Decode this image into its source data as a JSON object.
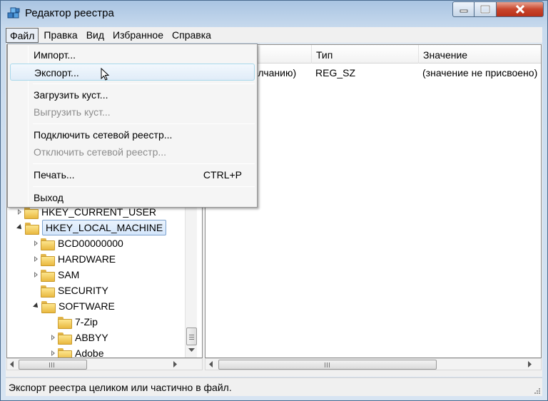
{
  "window": {
    "title": "Редактор реестра"
  },
  "menubar": {
    "items": [
      "Файл",
      "Правка",
      "Вид",
      "Избранное",
      "Справка"
    ]
  },
  "file_menu": {
    "items": [
      {
        "label": "Импорт...",
        "enabled": true
      },
      {
        "label": "Экспорт...",
        "enabled": true,
        "highlighted": true
      },
      {
        "label": "Загрузить куст...",
        "enabled": true
      },
      {
        "label": "Выгрузить куст...",
        "enabled": false
      },
      {
        "label": "Подключить сетевой реестр...",
        "enabled": true
      },
      {
        "label": "Отключить сетевой реестр...",
        "enabled": false
      },
      {
        "label": "Печать...",
        "enabled": true,
        "shortcut": "CTRL+P"
      },
      {
        "label": "Выход",
        "enabled": true
      }
    ]
  },
  "tree": {
    "items": [
      {
        "label": "HKEY_CURRENT_USER",
        "expander": "closed"
      },
      {
        "label": "HKEY_LOCAL_MACHINE",
        "expander": "open",
        "selected": true
      },
      {
        "label": "BCD00000000",
        "expander": "closed"
      },
      {
        "label": "HARDWARE",
        "expander": "closed"
      },
      {
        "label": "SAM",
        "expander": "closed"
      },
      {
        "label": "SECURITY",
        "expander": "none"
      },
      {
        "label": "SOFTWARE",
        "expander": "open"
      },
      {
        "label": "7-Zip",
        "expander": "none"
      },
      {
        "label": "ABBYY",
        "expander": "closed"
      },
      {
        "label": "Adobe",
        "expander": "closed"
      }
    ]
  },
  "list": {
    "columns": [
      "Тип",
      "Значение"
    ],
    "rows": [
      {
        "name": "олчанию)",
        "type": "REG_SZ",
        "value": "(значение не присвоено)"
      }
    ]
  },
  "status": {
    "text": "Экспорт реестра целиком или частично в файл."
  },
  "icons": {
    "app": "registry-cubes-icon",
    "folder": "folder-icon"
  },
  "colors": {
    "title_gradient": "#a9c4e2",
    "close_button": "#c8462c",
    "selection": "#d4e6fb"
  }
}
